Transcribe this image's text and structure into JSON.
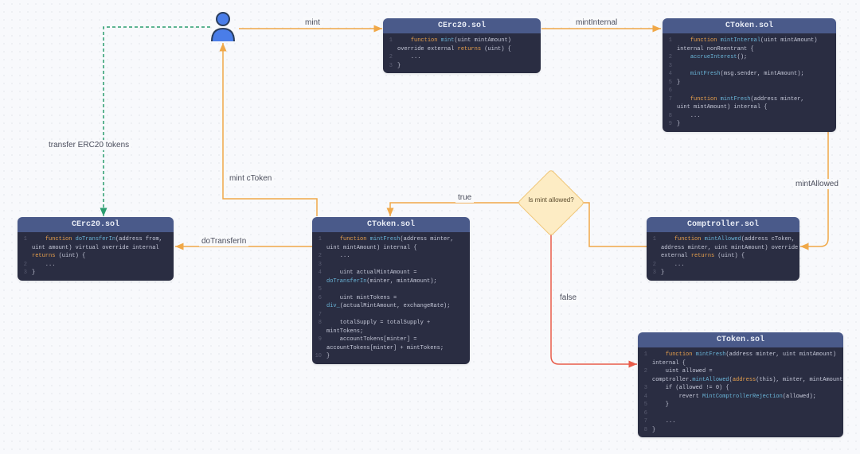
{
  "nodes": {
    "cerc20_top": {
      "title": "CErc20.sol",
      "lines": [
        {
          "n": "1",
          "t": "    function mint(uint mintAmount)",
          "hl": [
            [
              "function",
              "kw-func"
            ],
            [
              "mint",
              "kw-name"
            ]
          ]
        },
        {
          "n": "",
          "t": "override external returns (uint) {",
          "hl": [
            [
              "returns",
              "kw-ret"
            ]
          ]
        },
        {
          "n": "2",
          "t": "    ..."
        },
        {
          "n": "3",
          "t": "}"
        }
      ]
    },
    "ctoken_top": {
      "title": "CToken.sol",
      "lines": [
        {
          "n": "1",
          "t": "    function mintInternal(uint mintAmount)",
          "hl": [
            [
              "function",
              "kw-func"
            ],
            [
              "mintInternal",
              "kw-name"
            ]
          ]
        },
        {
          "n": "",
          "t": "internal nonReentrant {"
        },
        {
          "n": "2",
          "t": "    accrueInterest();",
          "hl": [
            [
              "accrueInterest",
              "kw-name"
            ]
          ]
        },
        {
          "n": "3",
          "t": ""
        },
        {
          "n": "4",
          "t": "    mintFresh(msg.sender, mintAmount);",
          "hl": [
            [
              "mintFresh",
              "kw-name"
            ]
          ]
        },
        {
          "n": "5",
          "t": "}"
        },
        {
          "n": "6",
          "t": ""
        },
        {
          "n": "7",
          "t": "    function mintFresh(address minter,",
          "hl": [
            [
              "function",
              "kw-func"
            ],
            [
              "mintFresh",
              "kw-name"
            ]
          ]
        },
        {
          "n": "",
          "t": "uint mintAmount) internal {"
        },
        {
          "n": "8",
          "t": "    ..."
        },
        {
          "n": "9",
          "t": "}"
        }
      ]
    },
    "cerc20_bottom": {
      "title": "CErc20.sol",
      "lines": [
        {
          "n": "1",
          "t": "    function doTransferIn(address from,",
          "hl": [
            [
              "function",
              "kw-func"
            ],
            [
              "doTransferIn",
              "kw-name"
            ]
          ]
        },
        {
          "n": "",
          "t": "uint amount) virtual override internal"
        },
        {
          "n": "",
          "t": "returns (uint) {",
          "hl": [
            [
              "returns",
              "kw-ret"
            ]
          ]
        },
        {
          "n": "2",
          "t": "    ..."
        },
        {
          "n": "3",
          "t": "}"
        }
      ]
    },
    "ctoken_mid": {
      "title": "CToken.sol",
      "lines": [
        {
          "n": "1",
          "t": "    function mintFresh(address minter,",
          "hl": [
            [
              "function",
              "kw-func"
            ],
            [
              "mintFresh",
              "kw-name"
            ]
          ]
        },
        {
          "n": "",
          "t": "uint mintAmount) internal {"
        },
        {
          "n": "2",
          "t": "    ..."
        },
        {
          "n": "3",
          "t": ""
        },
        {
          "n": "4",
          "t": "    uint actualMintAmount ="
        },
        {
          "n": "",
          "t": "doTransferIn(minter, mintAmount);",
          "hl": [
            [
              "doTransferIn",
              "kw-name"
            ]
          ]
        },
        {
          "n": "5",
          "t": ""
        },
        {
          "n": "6",
          "t": "    uint mintTokens ="
        },
        {
          "n": "",
          "t": "div_(actualMintAmount, exchangeRate);",
          "hl": [
            [
              "div_",
              "kw-name"
            ]
          ]
        },
        {
          "n": "7",
          "t": ""
        },
        {
          "n": "8",
          "t": "    totalSupply = totalSupply +"
        },
        {
          "n": "",
          "t": "mintTokens;"
        },
        {
          "n": "9",
          "t": "    accountTokens[minter] ="
        },
        {
          "n": "",
          "t": "accountTokens[minter] + mintTokens;"
        },
        {
          "n": "10",
          "t": "}"
        }
      ]
    },
    "comptroller": {
      "title": "Comptroller.sol",
      "lines": [
        {
          "n": "1",
          "t": "    function mintAllowed(address cToken,",
          "hl": [
            [
              "function",
              "kw-func"
            ],
            [
              "mintAllowed",
              "kw-name"
            ]
          ]
        },
        {
          "n": "",
          "t": "address minter, uint mintAmount) override"
        },
        {
          "n": "",
          "t": "external returns (uint) {",
          "hl": [
            [
              "returns",
              "kw-ret"
            ]
          ]
        },
        {
          "n": "2",
          "t": "    ..."
        },
        {
          "n": "3",
          "t": "}"
        }
      ]
    },
    "ctoken_bottom": {
      "title": "CToken.sol",
      "lines": [
        {
          "n": "1",
          "t": "    function mintFresh(address minter, uint mintAmount)",
          "hl": [
            [
              "function",
              "kw-func"
            ],
            [
              "mintFresh",
              "kw-name"
            ]
          ]
        },
        {
          "n": "",
          "t": "internal {"
        },
        {
          "n": "2",
          "t": "    uint allowed ="
        },
        {
          "n": "",
          "t": "comptroller.mintAllowed(address(this), minter, mintAmount);",
          "hl": [
            [
              "mintAllowed",
              "kw-name"
            ],
            [
              "address",
              "kw-type"
            ]
          ]
        },
        {
          "n": "3",
          "t": "    if (allowed != 0) {"
        },
        {
          "n": "4",
          "t": "        revert MintComptrollerRejection(allowed);",
          "hl": [
            [
              "MintComptrollerRejection",
              "kw-name"
            ]
          ]
        },
        {
          "n": "5",
          "t": "    }"
        },
        {
          "n": "6",
          "t": ""
        },
        {
          "n": "7",
          "t": "    ..."
        },
        {
          "n": "8",
          "t": "}"
        }
      ]
    }
  },
  "labels": {
    "mint": "mint",
    "mintInternal": "mintInternal",
    "mintAllowed": "mintAllowed",
    "transferERC20": "transfer ERC20 tokens",
    "mintCToken": "mint cToken",
    "doTransferIn": "doTransferIn",
    "true": "true",
    "false": "false",
    "isMintAllowed": "Is mint allowed?"
  },
  "colors": {
    "orange": "#f0a848",
    "green": "#2a9d6f",
    "red": "#e85c4a",
    "userFill": "#4a7de8",
    "userStroke": "#2a3d5c"
  }
}
